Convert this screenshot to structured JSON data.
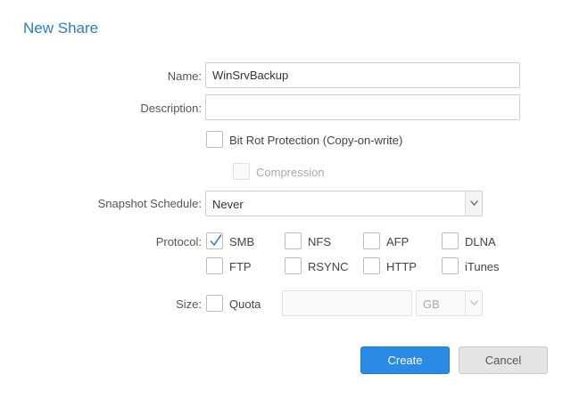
{
  "dialog": {
    "title": "New Share"
  },
  "form": {
    "name_label": "Name:",
    "name_value": "WinSrvBackup",
    "description_label": "Description:",
    "description_value": "",
    "bitrot_label": "Bit Rot Protection (Copy-on-write)",
    "bitrot_checked": false,
    "compression_label": "Compression",
    "compression_checked": false,
    "snapshot_label": "Snapshot Schedule:",
    "snapshot_value": "Never",
    "protocol_label": "Protocol:",
    "protocols": [
      {
        "label": "SMB",
        "checked": true
      },
      {
        "label": "NFS",
        "checked": false
      },
      {
        "label": "AFP",
        "checked": false
      },
      {
        "label": "DLNA",
        "checked": false
      },
      {
        "label": "FTP",
        "checked": false
      },
      {
        "label": "RSYNC",
        "checked": false
      },
      {
        "label": "HTTP",
        "checked": false
      },
      {
        "label": "iTunes",
        "checked": false
      }
    ],
    "size_label": "Size:",
    "quota_label": "Quota",
    "quota_checked": false,
    "quota_value": "",
    "unit_value": "GB"
  },
  "buttons": {
    "create": "Create",
    "cancel": "Cancel"
  },
  "colors": {
    "title": "#2f7bc4",
    "primary_button": "#2a8ae6",
    "check": "#3a80c9"
  },
  "icons": {
    "checkmark": "checkmark-icon",
    "dropdown": "chevron-down-icon"
  }
}
